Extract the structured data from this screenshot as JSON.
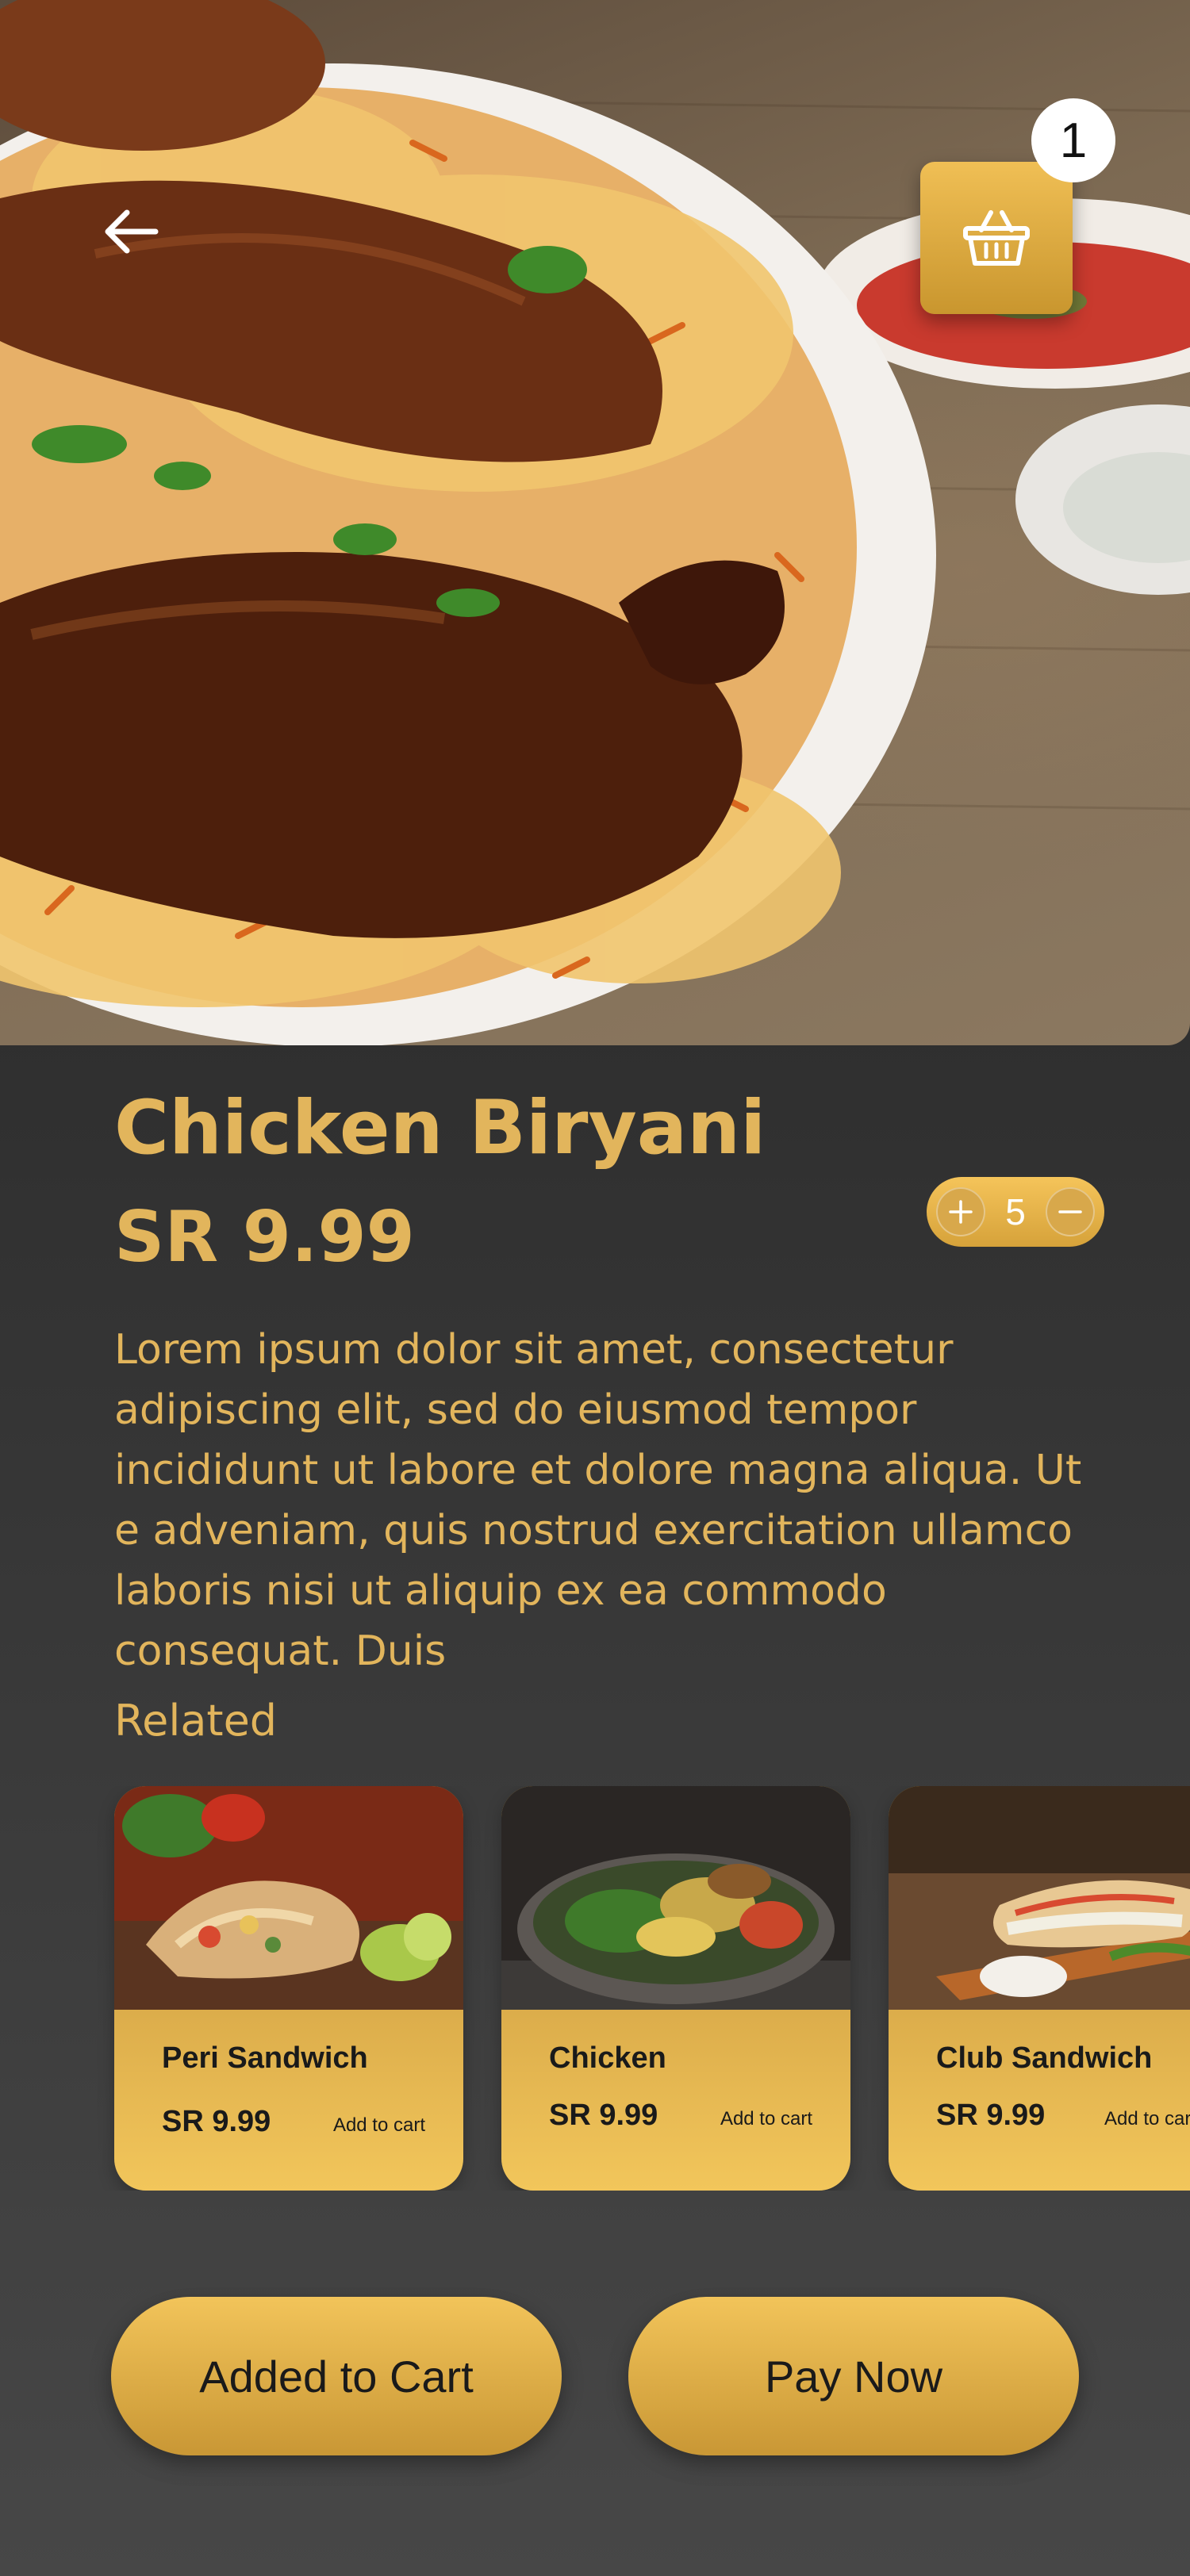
{
  "hero": {
    "back_icon": "arrow-left-icon",
    "cart_icon": "shopping-basket-icon",
    "cart_count": "1"
  },
  "product": {
    "name": "Chicken Biryani",
    "price": "SR 9.99",
    "quantity": "5",
    "description": "Lorem ipsum dolor sit amet, consectetur adipiscing elit, sed do eiusmod tempor incididunt ut labore et dolore magna aliqua. Ut e adveniam, quis nostrud exercitation ullamco laboris nisi ut aliquip ex ea commodo consequat. Duis"
  },
  "related": {
    "label": "Related",
    "items": [
      {
        "name": "Peri Sandwich",
        "price": "SR 9.99",
        "add_label": "Add to cart"
      },
      {
        "name": "Chicken",
        "price": "SR 9.99",
        "add_label": "Add to cart"
      },
      {
        "name": "Club Sandwich",
        "price": "SR 9.99",
        "add_label": "Add to cart"
      }
    ]
  },
  "actions": {
    "added_label": "Added to Cart",
    "pay_label": "Pay Now"
  },
  "colors": {
    "accent": "#e2b55c",
    "button_gold": "#f2c45a",
    "background": "#2f2f2f"
  }
}
